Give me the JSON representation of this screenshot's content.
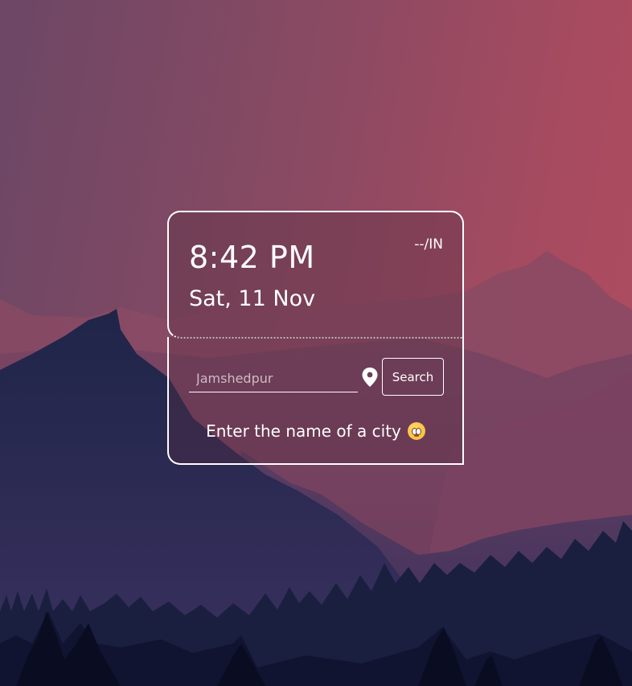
{
  "weather_card": {
    "time": "8:42 PM",
    "date": "Sat, 11 Nov",
    "country": "--/IN"
  },
  "search": {
    "placeholder": "Jamshedpur",
    "value": "",
    "button_label": "Search"
  },
  "message": "Enter the name of a city",
  "icons": {
    "location": "location-pin-icon",
    "emoji": "flushed-face-emoji"
  },
  "colors": {
    "sky_left": "#6c4766",
    "sky_right": "#b04c5f",
    "far_mountain": "#8d4f66",
    "mid_mountain": "#5a3b5c",
    "near_mountain": "#26284d",
    "trees_dark": "#141a36",
    "card_border": "#ffffff"
  }
}
